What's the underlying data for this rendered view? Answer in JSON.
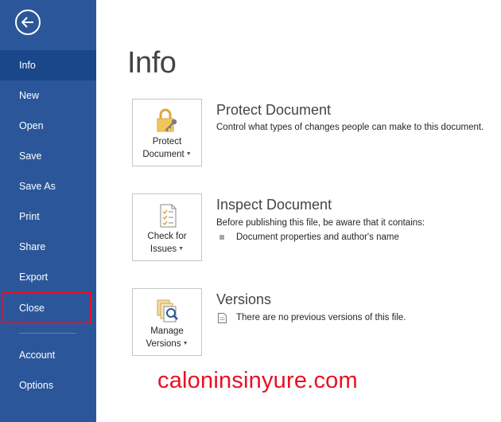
{
  "sidebar": {
    "back_icon": "back-arrow-icon",
    "items": [
      {
        "label": "Info"
      },
      {
        "label": "New"
      },
      {
        "label": "Open"
      },
      {
        "label": "Save"
      },
      {
        "label": "Save As"
      },
      {
        "label": "Print"
      },
      {
        "label": "Share"
      },
      {
        "label": "Export"
      },
      {
        "label": "Close"
      },
      {
        "label": "Account"
      },
      {
        "label": "Options"
      }
    ],
    "selected": "Info",
    "highlighted": "Close",
    "bg_color": "#2b579a",
    "highlight_color": "#e81123"
  },
  "main": {
    "title": "Info",
    "sections": [
      {
        "tile_label_1": "Protect",
        "tile_label_2": "Document",
        "title": "Protect Document",
        "description": "Control what types of changes people can make to this document."
      },
      {
        "tile_label_1": "Check for",
        "tile_label_2": "Issues",
        "title": "Inspect Document",
        "description": "Before publishing this file, be aware that it contains:",
        "bullet": "Document properties and author's name"
      },
      {
        "tile_label_1": "Manage",
        "tile_label_2": "Versions",
        "title": "Versions",
        "note": "There are no previous versions of this file."
      }
    ]
  },
  "watermark": "caloninsinyure.com"
}
